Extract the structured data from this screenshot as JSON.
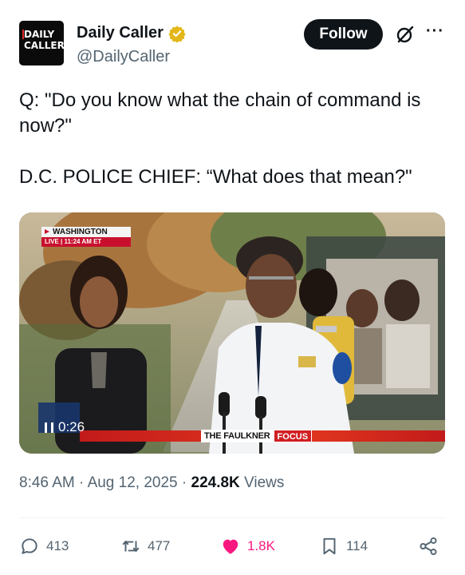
{
  "author": {
    "display_name": "Daily Caller",
    "handle": "@DailyCaller",
    "logo_line1": "DAILY",
    "logo_line2": "CALLER",
    "verified_color": "#e2b719"
  },
  "header": {
    "follow_label": "Follow",
    "grok_icon": "grok-icon",
    "more_label": "···"
  },
  "tweet": {
    "line1": "Q: \"Do you know what the chain of command is now?\"",
    "line2": "D.C. POLICE CHIEF: “What does that mean?\""
  },
  "video": {
    "location": "WASHINGTON",
    "live_text": "LIVE | 11:24 AM ET",
    "elapsed": "0:26",
    "show_name": "THE FAULKNER",
    "show_tag": "FOCUS",
    "accent_color": "#c8102e"
  },
  "meta": {
    "time": "8:46 AM",
    "separator": " · ",
    "date": "Aug 12, 2025",
    "views_count": "224.8K",
    "views_label": " Views"
  },
  "actions": {
    "replies": "413",
    "reposts": "477",
    "likes": "1.8K",
    "bookmarks": "114",
    "like_color": "#f91880"
  }
}
